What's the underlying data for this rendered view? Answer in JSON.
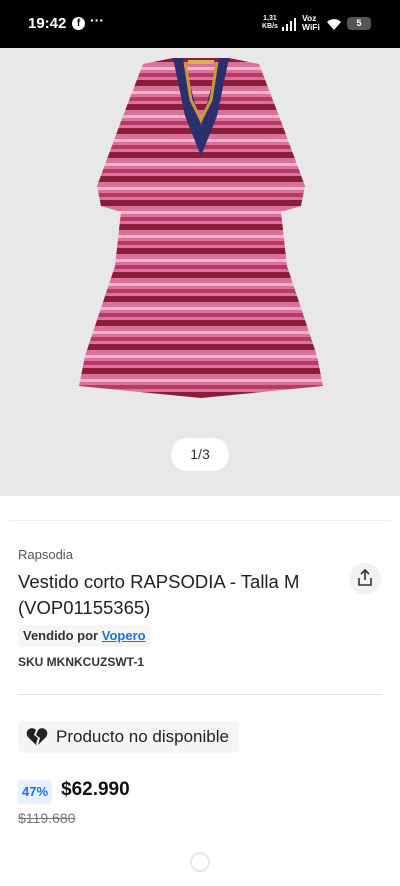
{
  "status_bar": {
    "time": "19:42",
    "speed_value": "1,31",
    "speed_unit": "KB/s",
    "voz": "Voz",
    "wifi": "WiFi",
    "battery": "5",
    "icons": [
      "facebook-icon",
      "more-icon",
      "signal-icon",
      "wifi-icon",
      "battery-icon"
    ]
  },
  "gallery": {
    "pager": "1/3",
    "image": "pink printed dress with embroidered neckline"
  },
  "product": {
    "brand": "Rapsodia",
    "title": "Vestido corto RAPSODIA - Talla M (VOP01155365)",
    "seller_prefix": "Vendido por",
    "seller_name": "Vopero",
    "sku": "SKU MKNKCUZSWT-1",
    "availability": "Producto no disponible",
    "discount": "47%",
    "price": "$62.990",
    "old_price": "$119.680"
  },
  "colors": {
    "accent": "#1a73e8",
    "dress_pink": "#d9719a",
    "dress_maroon": "#8a1c3c"
  }
}
